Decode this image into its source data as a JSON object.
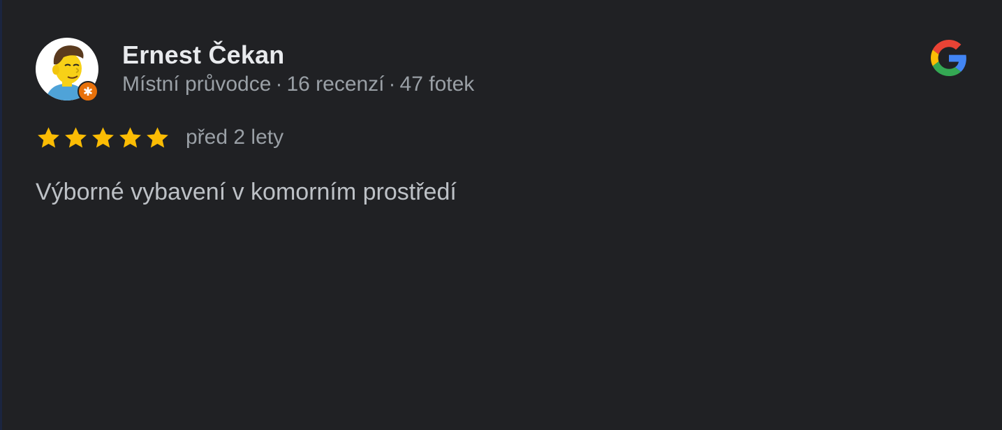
{
  "review": {
    "author": {
      "name": "Ernest Čekan",
      "badge_icon": "local-guide-badge-icon",
      "role": "Místní průvodce",
      "reviews": "16 recenzí",
      "photos": "47 fotek",
      "separator": "·"
    },
    "rating": 5,
    "rating_max": 5,
    "star_color": "#fbbc04",
    "date": "před 2 lety",
    "text": "Výborné vybavení v komorním prostředí",
    "source_icon": "google-logo-icon"
  },
  "colors": {
    "background": "#202124",
    "name": "#e8eaed",
    "meta": "#9aa0a6",
    "text": "#bdc1c6",
    "badge": "#e8710a"
  }
}
